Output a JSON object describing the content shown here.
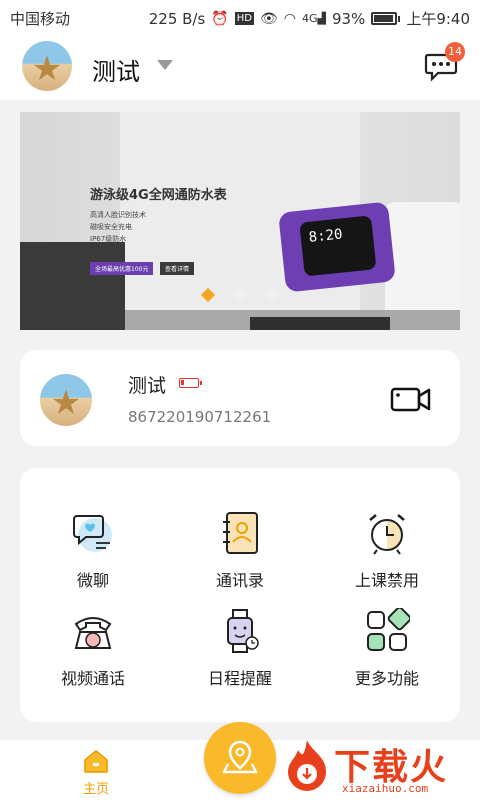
{
  "status_bar": {
    "carrier": "中国移动",
    "speed": "225 B/s",
    "network": "4G",
    "battery": "93%",
    "time": "上午9:40"
  },
  "header": {
    "device_name": "测试",
    "message_badge": "14"
  },
  "banner": {
    "headline": "游泳级4G全网通防水表",
    "features": [
      "高清人脸识别技术",
      "磁吸安全充电",
      "IP67级防水"
    ],
    "promo_label": "全场最高优惠100元",
    "detail_label": "查看详情",
    "watch_time": "8:20",
    "active_slide": 1,
    "slide_count": 3
  },
  "device_card": {
    "name": "测试",
    "device_id": "867220190712261"
  },
  "functions": [
    {
      "label": "微聊",
      "icon": "chat-bubble-icon"
    },
    {
      "label": "通讯录",
      "icon": "contacts-book-icon"
    },
    {
      "label": "上课禁用",
      "icon": "alarm-clock-icon"
    },
    {
      "label": "视频通话",
      "icon": "telephone-icon"
    },
    {
      "label": "日程提醒",
      "icon": "smartwatch-icon"
    },
    {
      "label": "更多功能",
      "icon": "grid-apps-icon"
    }
  ],
  "bottom_nav": {
    "home_label": "主页"
  },
  "watermark": {
    "text": "下载火",
    "sub": "xiazaihuo.com"
  },
  "colors": {
    "accent": "#fab92b",
    "badge": "#f25d3c",
    "low_battery": "#e0362b",
    "watermark": "#e8401c"
  }
}
